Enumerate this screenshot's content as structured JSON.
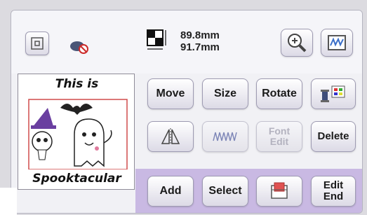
{
  "topbar": {
    "width_value": "89.8mm",
    "height_value": "91.7mm"
  },
  "pattern": {
    "top_text": "This is",
    "bottom_text": "Spooktacular"
  },
  "buttons": {
    "move": "Move",
    "size": "Size",
    "rotate": "Rotate",
    "font_edit": "Font Edit",
    "delete": "Delete",
    "add": "Add",
    "select": "Select",
    "edit_end": "Edit End"
  }
}
